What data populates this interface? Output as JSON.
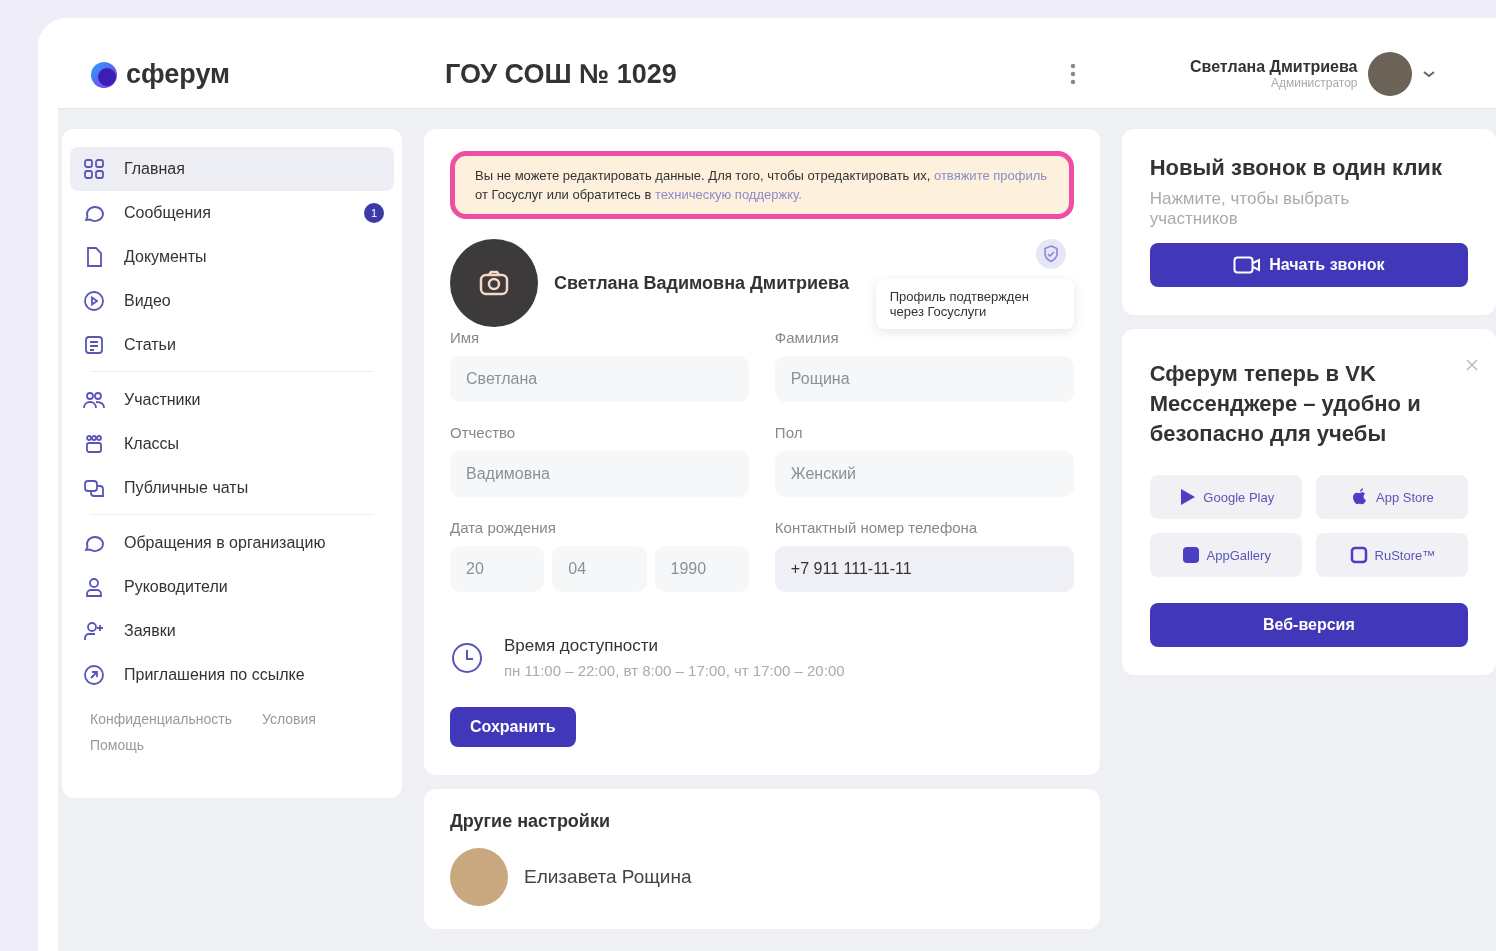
{
  "header": {
    "logo": "сферум",
    "org_title": "ГОУ СОШ № 1029",
    "user": {
      "name": "Светлана Дмитриева",
      "role": "Администратор"
    }
  },
  "sidebar": {
    "groups": [
      [
        {
          "label": "Главная",
          "selected": true
        },
        {
          "label": "Сообщения",
          "selected": false,
          "badge": "1"
        },
        {
          "label": "Документы",
          "selected": false
        },
        {
          "label": "Видео",
          "selected": false
        },
        {
          "label": "Статьи",
          "selected": false
        }
      ],
      [
        {
          "label": "Участники",
          "selected": false
        },
        {
          "label": "Классы",
          "selected": false
        },
        {
          "label": "Публичные чаты",
          "selected": false
        }
      ],
      [
        {
          "label": "Обращения в организацию",
          "selected": false
        },
        {
          "label": "Руководители",
          "selected": false
        },
        {
          "label": "Заявки",
          "selected": false
        },
        {
          "label": "Приглашения по ссылке",
          "selected": false
        }
      ]
    ],
    "footer_links": [
      "Конфиденциальность",
      "Условия",
      "Помощь"
    ]
  },
  "profile": {
    "alert": {
      "highlighted": true,
      "parts": [
        {
          "kind": "text",
          "text": "Вы не можете редактировать данные. Для того, чтобы отредактировать их,"
        },
        {
          "kind": "link",
          "text": "отвяжите профиль"
        },
        {
          "kind": "text",
          "text": "от Госуслуг или обратитесь в"
        },
        {
          "kind": "link",
          "text": "техническую поддержку."
        }
      ]
    },
    "full_name": "Светлана Вадимовна Дмитриева",
    "tooltip": "Профиль подтвержден через Госуслуги",
    "fields": [
      {
        "label": "Имя",
        "value": "Светлана",
        "disabled": true
      },
      {
        "label": "Фамилия",
        "value": "Рощина",
        "disabled": true
      },
      {
        "label": "Отчество",
        "value": "Вадимовна",
        "disabled": true
      },
      {
        "label": "Пол",
        "value": "Женский",
        "disabled": true
      }
    ],
    "birth_date": {
      "label": "Дата рождения",
      "parts": [
        "20",
        "04",
        "1990"
      ],
      "disabled": true
    },
    "phone": {
      "label": "Контактный номер телефона",
      "value": "+7 911 111-11-11",
      "disabled": false
    },
    "availability": {
      "title": "Время доступности",
      "value": "пн 11:00 – 22:00, вт 8:00 – 17:00, чт 17:00 – 20:00"
    },
    "save_button": "Сохранить"
  },
  "other_settings": {
    "title": "Другие настройки",
    "person": "Елизавета Рощина"
  },
  "call_card": {
    "title": "Новый звонок в один клик",
    "subtitle": "Нажмите, чтобы выбрать участников",
    "button": "Начать звонок"
  },
  "promo_card": {
    "title": "Сферум теперь в VK Мессенджере – удобно и безопасно для учебы",
    "stores": [
      "Google Play",
      "App Store",
      "AppGallery",
      "RuStore™"
    ],
    "button": "Веб-версия"
  }
}
